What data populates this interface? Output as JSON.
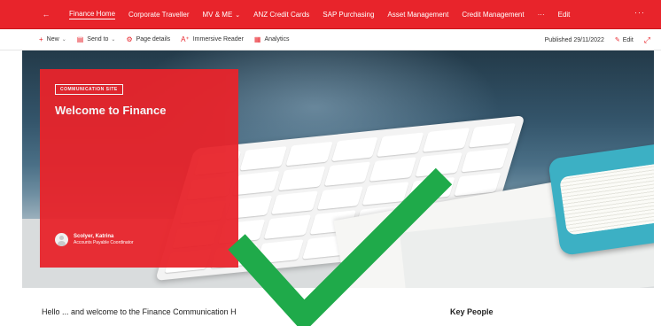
{
  "topnav": {
    "items": [
      {
        "label": "Finance Home"
      },
      {
        "label": "Corporate Traveller"
      },
      {
        "label": "MV & ME"
      },
      {
        "label": "ANZ Credit Cards"
      },
      {
        "label": "SAP Purchasing"
      },
      {
        "label": "Asset Management"
      },
      {
        "label": "Credit Management"
      },
      {
        "label": "Edit"
      }
    ],
    "more": "···",
    "overflow": "···"
  },
  "cmdbar": {
    "new": "New",
    "send_to": "Send to",
    "page_details": "Page details",
    "immersive_reader": "Immersive Reader",
    "analytics": "Analytics",
    "published": "Published 29/11/2022",
    "edit": "Edit"
  },
  "hero": {
    "badge": "COMMUNICATION SITE",
    "title": "Welcome to Finance",
    "author_name": "Scolyer, Katrina",
    "author_role": "Accounts Payable Coordinator"
  },
  "content": {
    "hello": "Hello ... and welcome to the Finance Communication H",
    "key_people": "Key People"
  },
  "colors": {
    "brand_red": "#e8242b",
    "check_green": "#1faa4a"
  }
}
